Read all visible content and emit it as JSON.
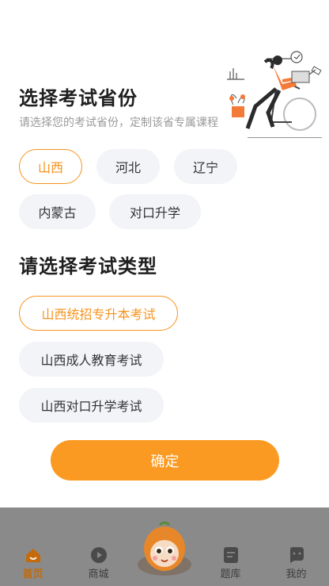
{
  "province_section": {
    "title": "选择考试省份",
    "subtitle": "请选择您的考试省份，定制该省专属课程",
    "options": [
      "山西",
      "河北",
      "辽宁",
      "内蒙古",
      "对口升学"
    ],
    "selected": "山西"
  },
  "type_section": {
    "title": "请选择考试类型",
    "options": [
      "山西统招专升本考试",
      "山西成人教育考试",
      "山西对口升学考试"
    ],
    "selected": "山西统招专升本考试"
  },
  "confirm_label": "确定",
  "tabbar": {
    "items": [
      {
        "label": "首页",
        "icon": "home-icon",
        "active": true
      },
      {
        "label": "商城",
        "icon": "play-bag-icon",
        "active": false
      },
      {
        "label": "题库",
        "icon": "book-icon",
        "active": false
      },
      {
        "label": "我的",
        "icon": "chat-face-icon",
        "active": false
      }
    ],
    "center_icon": "orange-mascot-icon"
  },
  "colors": {
    "accent": "#f7931e",
    "confirm_bg": "#fb9a22",
    "chip_bg": "#f3f4f8",
    "overlay": "#8a8a8a"
  }
}
